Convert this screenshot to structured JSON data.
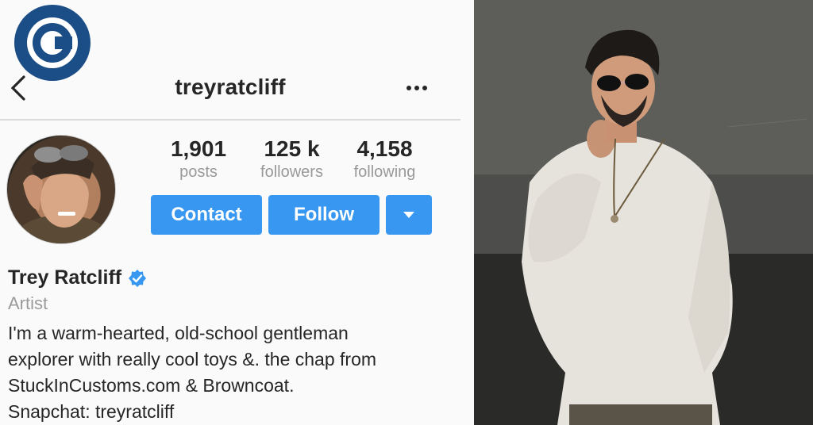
{
  "brand": {
    "logo_letter": "C",
    "logo_color": "#1b4d86"
  },
  "header": {
    "username": "treyratcliff",
    "back_icon": "chevron-left-icon",
    "more_icon": "more-horizontal-icon"
  },
  "profile": {
    "stats": [
      {
        "value": "1,901",
        "label": "posts"
      },
      {
        "value": "125 k",
        "label": "followers"
      },
      {
        "value": "4,158",
        "label": "following"
      }
    ],
    "buttons": {
      "contact": "Contact",
      "follow": "Follow",
      "dropdown_icon": "caret-down-icon"
    },
    "full_name": "Trey Ratcliff",
    "verified_icon": "verified-badge-icon",
    "category": "Artist",
    "bio_lines": [
      "I'm a warm-hearted, old-school gentleman",
      "explorer with really cool toys &. the chap from",
      "StuckInCustoms.com & Browncoat.",
      "Snapchat: treyratcliff"
    ]
  },
  "colors": {
    "button_blue": "#3897f0",
    "verified_blue": "#3897f0",
    "muted_text": "#999999"
  }
}
